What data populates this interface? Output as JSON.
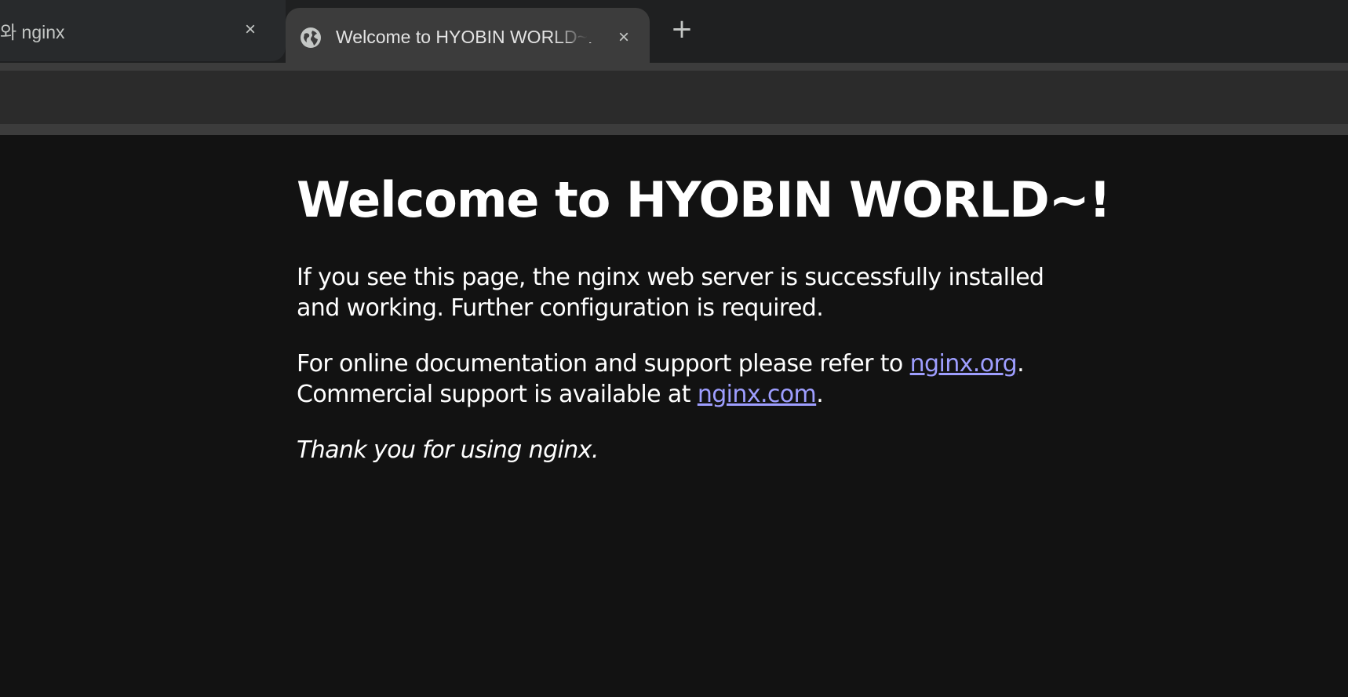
{
  "browser": {
    "tabs": [
      {
        "title": "와 nginx",
        "active": false
      },
      {
        "title": "Welcome to HYOBIN WORLD~!",
        "active": true
      }
    ],
    "close_icon": "×",
    "new_tab_icon": "+"
  },
  "page": {
    "heading": "Welcome to HYOBIN WORLD~!",
    "para1": "If you see this page, the nginx web server is successfully installed and working. Further configuration is required.",
    "para2_prefix": "For online documentation and support please refer to ",
    "link_org": "nginx.org",
    "para2_mid": ".",
    "para2_line2_prefix": "Commercial support is available at ",
    "link_com": "nginx.com",
    "para2_suffix": ".",
    "thanks": "Thank you for using nginx."
  },
  "colors": {
    "background": "#121212",
    "link": "#9e9eff",
    "tab_active": "#3c3c3c",
    "tabstrip": "#1f2021"
  }
}
